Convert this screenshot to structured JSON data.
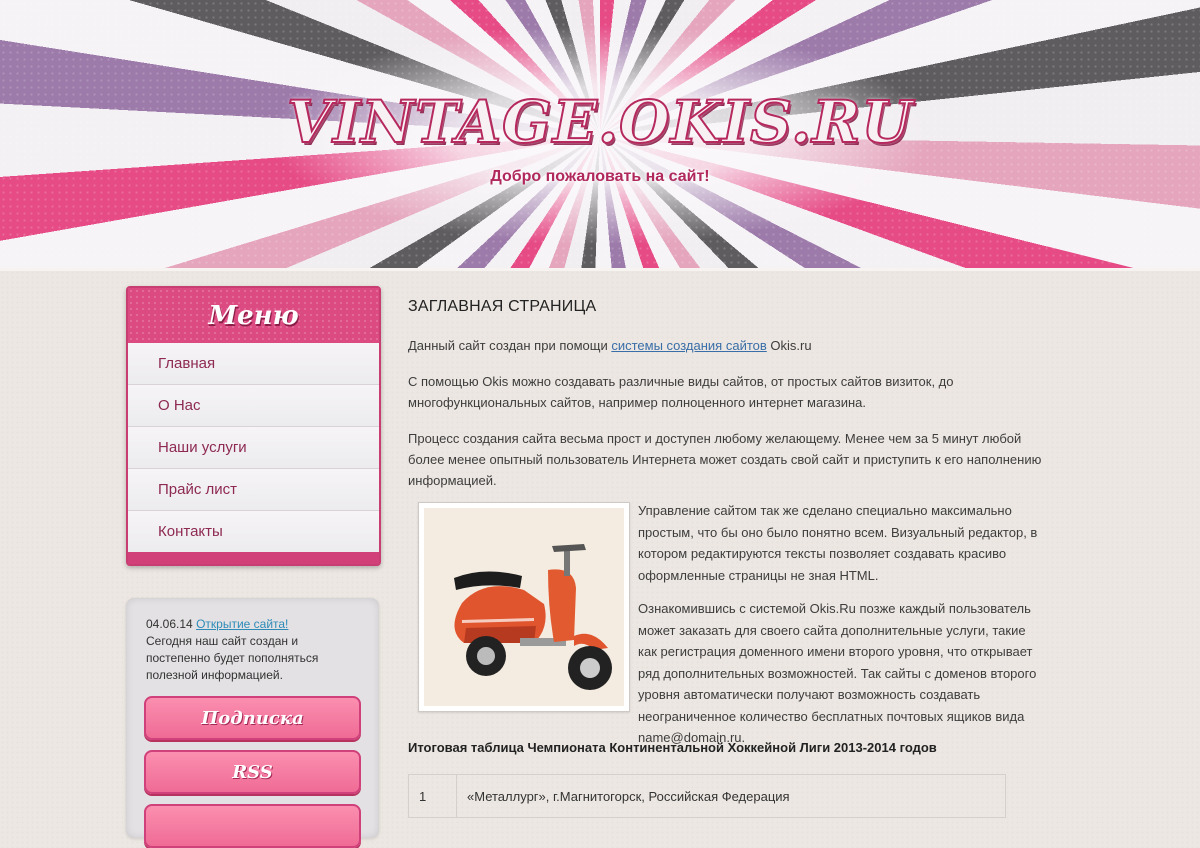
{
  "header": {
    "title": "VINTAGE.OKIS.RU",
    "subtitle": "Добро пожаловать на сайт!"
  },
  "menu": {
    "title": "Меню",
    "items": [
      {
        "label": "Главная"
      },
      {
        "label": "О Нас"
      },
      {
        "label": "Наши услуги"
      },
      {
        "label": "Прайс лист"
      },
      {
        "label": "Контакты"
      }
    ]
  },
  "news": {
    "date": "04.06.14",
    "link": "Открытие сайта!",
    "text": "Сегодня наш сайт создан и постепенно будет пополняться полезной информацией."
  },
  "sidebar_buttons": {
    "subscribe": "Подписка",
    "rss": "RSS",
    "third": ""
  },
  "content": {
    "title": "ЗАГЛАВНАЯ СТРАНИЦА",
    "p1_before": "Данный сайт создан при помощи ",
    "p1_link": "системы создания сайтов",
    "p1_after": " Okis.ru",
    "p2": "С помощью Okis можно создавать различные виды сайтов, от простых сайтов визиток, до многофункциональных сайтов, например полноценного интернет магазина.",
    "p3": "Процесс создания сайта весьма прост и доступен любому желающему. Менее чем за 5 минут любой более менее опытный пользователь Интернета может создать свой сайт и приступить к его наполнению информацией.",
    "p4": "Управление сайтом так же сделано специально максимально простым, что бы оно было понятно всем. Визуальный редактор, в котором редактируются тексты позволяет создавать красиво оформленные страницы не зная HTML.",
    "p5": "Ознакомившись с системой Okis.Ru позже каждый пользователь может заказать для своего сайта дополнительные услуги, такие как регистрация доменного имени второго уровня, что открывает ряд дополнительных возможностей. Так сайты с доменов второго уровня автоматически получают возможность создавать неограниченное количество бесплатных почтовых ящиков вида name@domain.ru.",
    "table_title": "Итоговая таблица Чемпионата Континентальной Хоккейной Лиги 2013-2014 годов",
    "table_rows": [
      {
        "num": "1",
        "team": "«Металлург», г.Магнитогорск, Российская Федерация"
      }
    ]
  },
  "colors": {
    "accent": "#dc4a82",
    "menu_text": "#8e2a52",
    "link": "#3a6ea8"
  }
}
